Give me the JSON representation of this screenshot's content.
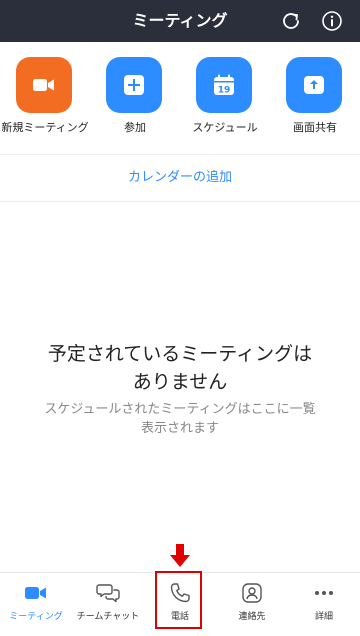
{
  "header": {
    "title": "ミーティング",
    "refresh_icon": "refresh-icon",
    "info_icon": "info-icon",
    "background": "#2b2e3b"
  },
  "actions": [
    {
      "label": "新規ミーティング",
      "icon": "video-camera-icon",
      "color": "#f26d21"
    },
    {
      "label": "参加",
      "icon": "plus-icon",
      "color": "#2d8cff"
    },
    {
      "label": "スケジュール",
      "icon": "calendar-icon",
      "color": "#2d8cff",
      "calendar_day": "19"
    },
    {
      "label": "画面共有",
      "icon": "share-screen-icon",
      "color": "#2d8cff"
    }
  ],
  "add_calendar": "カレンダーの追加",
  "empty_state": {
    "title": "予定されているミーティングは\nありません",
    "subtitle": "スケジュールされたミーティングはここに一覧\n表示されます"
  },
  "bottom_nav": [
    {
      "label": "ミーティング",
      "icon": "video-camera-icon",
      "active": true
    },
    {
      "label": "チームチャット",
      "icon": "chat-bubbles-icon",
      "active": false
    },
    {
      "label": "電話",
      "icon": "phone-icon",
      "active": false,
      "highlighted": true
    },
    {
      "label": "連絡先",
      "icon": "contacts-icon",
      "active": false
    },
    {
      "label": "詳細",
      "icon": "more-icon",
      "active": false
    }
  ],
  "colors": {
    "accent": "#2d8cff",
    "orange": "#f26d21",
    "highlight": "#e00000"
  }
}
